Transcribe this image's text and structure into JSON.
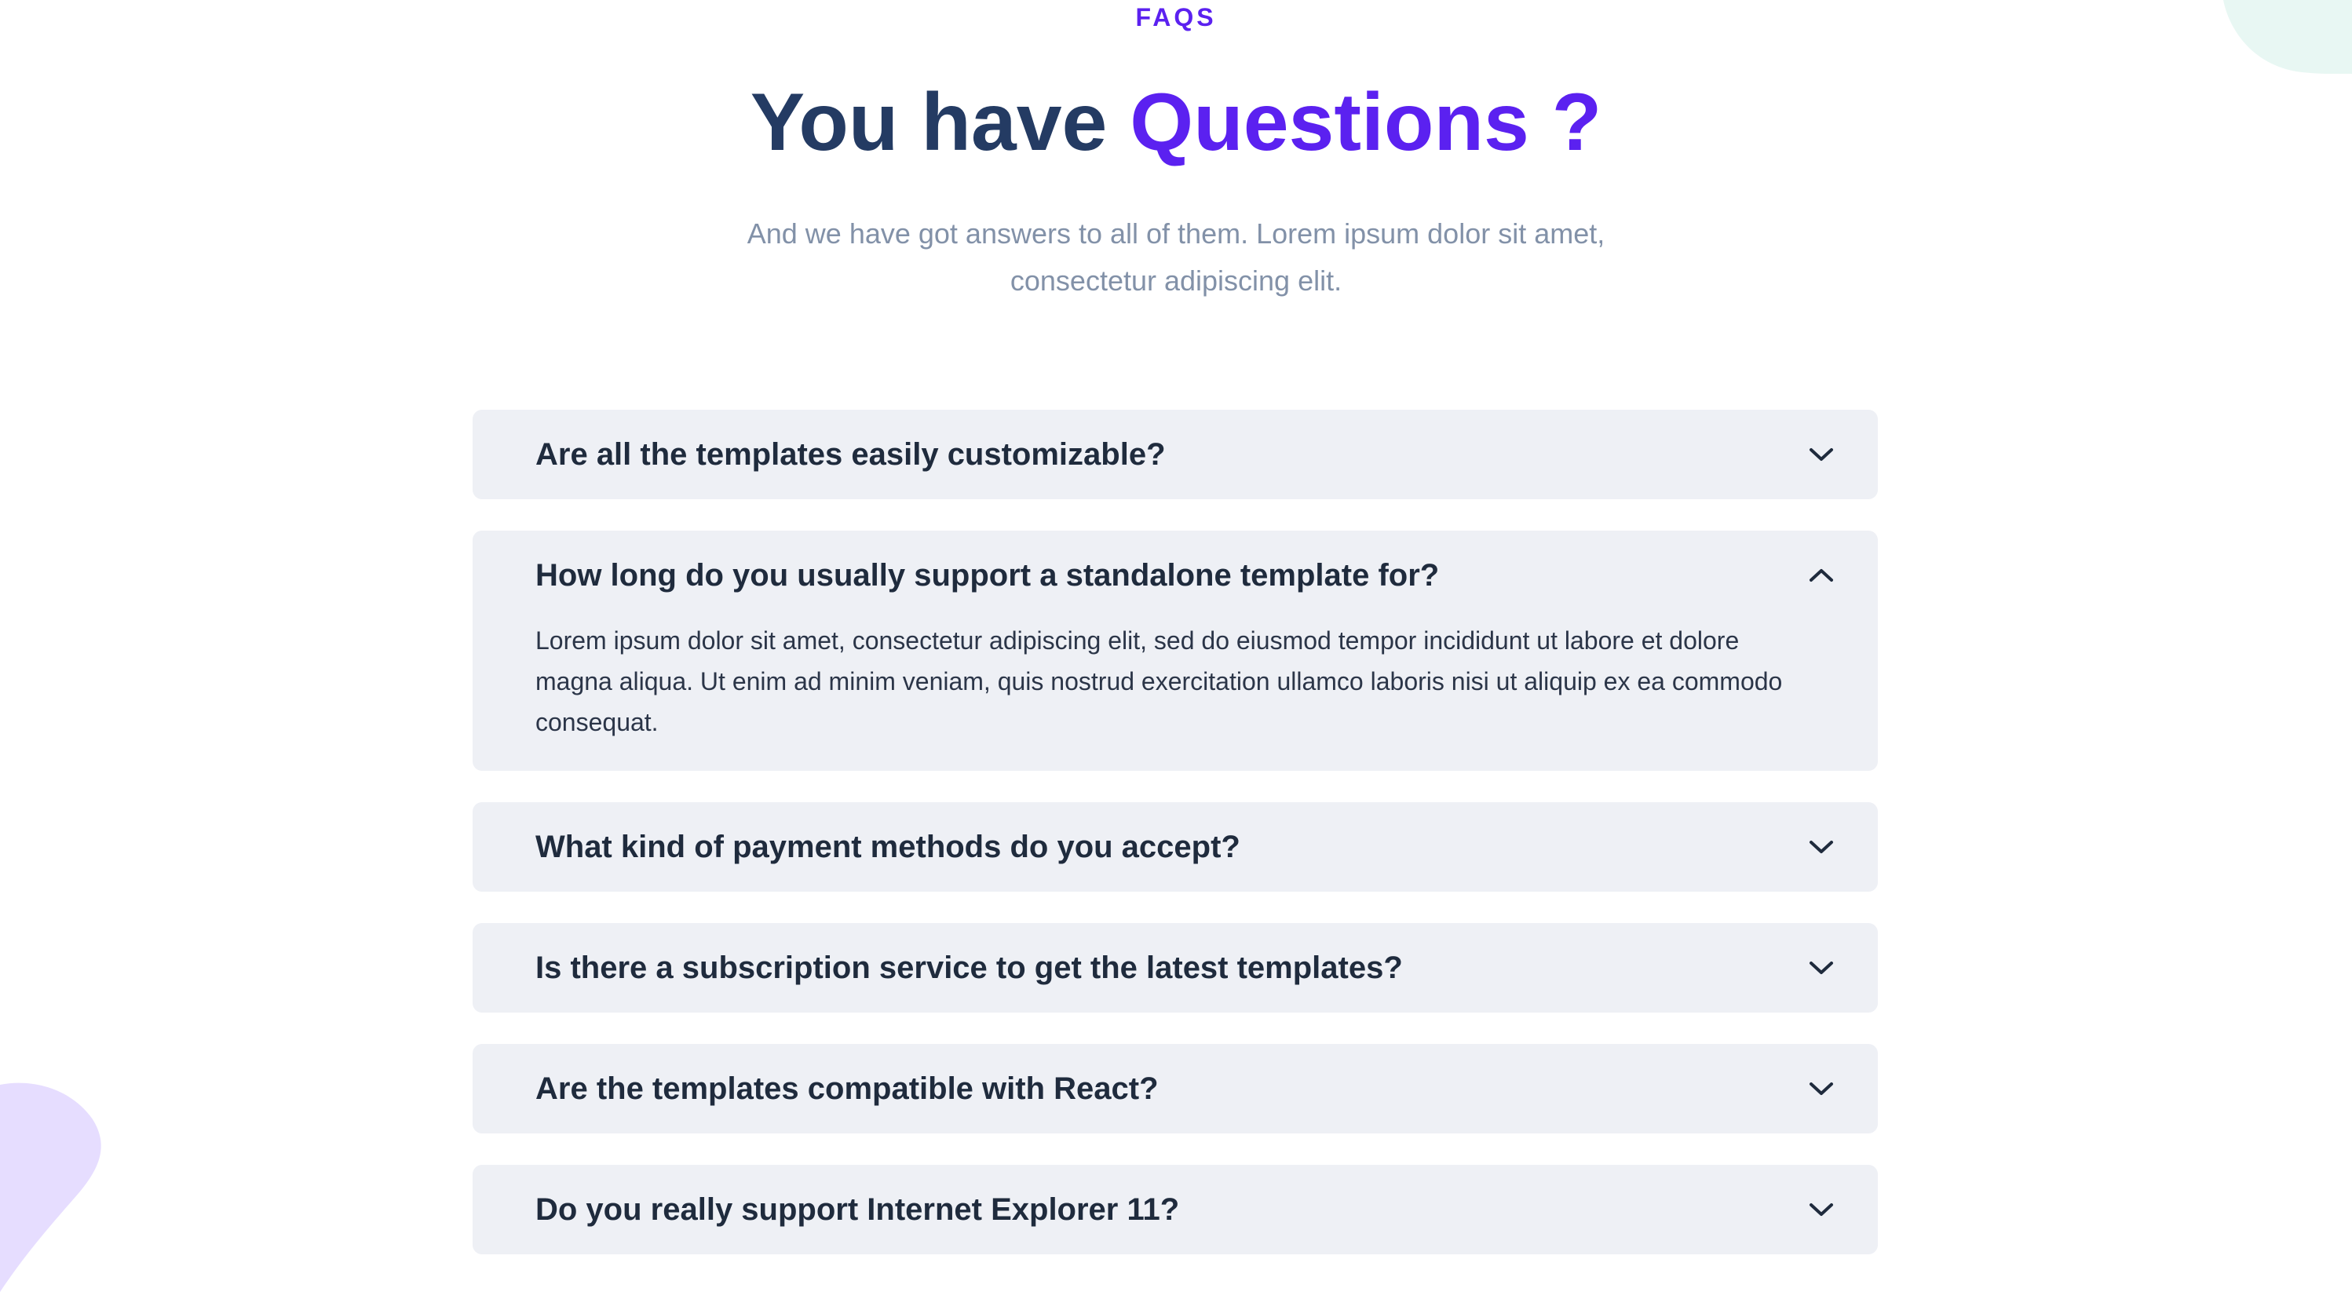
{
  "section": {
    "eyebrow": "FAQS",
    "title_main": "You have ",
    "title_accent": "Questions ?",
    "subtitle": "And we have got answers to all of them. Lorem ipsum dolor sit amet, consectetur adipiscing elit."
  },
  "colors": {
    "accent": "#5b21f0",
    "heading": "#243b63",
    "subtitle": "#8291a8",
    "card_bg": "#eef0f5",
    "blob_teal": "#e8f7f3",
    "blob_purple": "#e6ddff"
  },
  "faqs": [
    {
      "question": "Are all the templates easily customizable?",
      "expanded": false,
      "icon": "chevron-down-icon"
    },
    {
      "question": "How long do you usually support a standalone template for?",
      "expanded": true,
      "icon": "chevron-up-icon",
      "answer": "Lorem ipsum dolor sit amet, consectetur adipiscing elit, sed do eiusmod tempor incididunt ut labore et dolore magna aliqua. Ut enim ad minim veniam, quis nostrud exercitation ullamco laboris nisi ut aliquip ex ea commodo consequat."
    },
    {
      "question": "What kind of payment methods do you accept?",
      "expanded": false,
      "icon": "chevron-down-icon"
    },
    {
      "question": "Is there a subscription service to get the latest templates?",
      "expanded": false,
      "icon": "chevron-down-icon"
    },
    {
      "question": "Are the templates compatible with React?",
      "expanded": false,
      "icon": "chevron-down-icon"
    },
    {
      "question": "Do you really support Internet Explorer 11?",
      "expanded": false,
      "icon": "chevron-down-icon"
    }
  ]
}
